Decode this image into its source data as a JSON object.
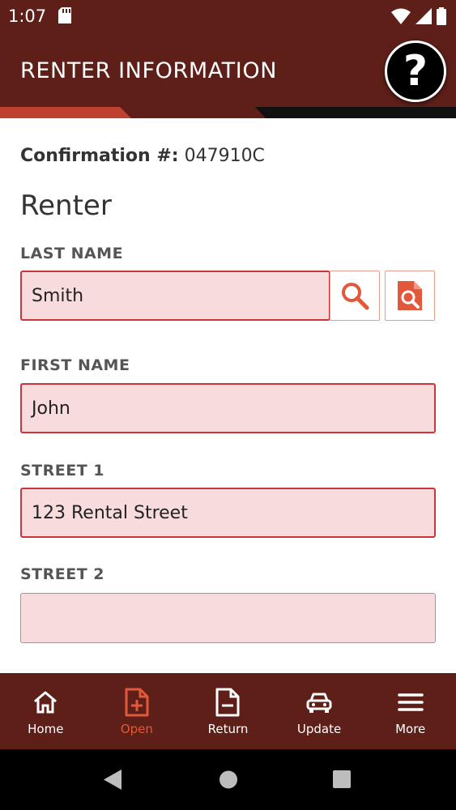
{
  "status_bar": {
    "time": "1:07"
  },
  "header": {
    "title": "RENTER INFORMATION",
    "help_label": "?"
  },
  "confirmation": {
    "label": "Confirmation #:",
    "value": "047910C"
  },
  "section_title": "Renter",
  "fields": {
    "last_name": {
      "label": "LAST NAME",
      "value": "Smith"
    },
    "first_name": {
      "label": "FIRST NAME",
      "value": "John"
    },
    "street1": {
      "label": "STREET 1",
      "value": "123 Rental Street"
    },
    "street2": {
      "label": "STREET 2",
      "value": ""
    }
  },
  "bottom_nav": {
    "items": [
      {
        "label": "Home",
        "icon": "home-icon"
      },
      {
        "label": "Open",
        "icon": "file-plus-icon",
        "active": true
      },
      {
        "label": "Return",
        "icon": "file-minus-icon"
      },
      {
        "label": "Update",
        "icon": "car-icon"
      },
      {
        "label": "More",
        "icon": "menu-icon"
      }
    ]
  },
  "colors": {
    "header_bg": "#5e1f19",
    "accent": "#e1583a",
    "field_bg": "#f8dbdd",
    "field_border": "#c9363a"
  }
}
